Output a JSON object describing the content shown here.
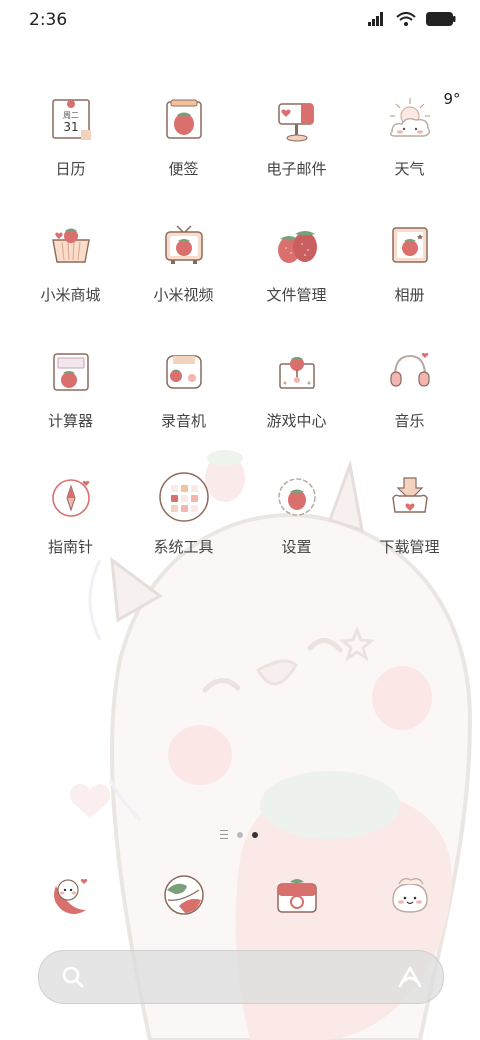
{
  "status_bar": {
    "time": "2:36"
  },
  "apps": [
    {
      "label": "日历",
      "icon": "calendar-icon",
      "calendar_day": "周二",
      "calendar_date": "31"
    },
    {
      "label": "便签",
      "icon": "notes-icon"
    },
    {
      "label": "电子邮件",
      "icon": "email-icon"
    },
    {
      "label": "天气",
      "icon": "weather-icon",
      "temperature": "9°"
    },
    {
      "label": "小米商城",
      "icon": "mi-store-icon"
    },
    {
      "label": "小米视频",
      "icon": "mi-video-icon"
    },
    {
      "label": "文件管理",
      "icon": "file-manager-icon"
    },
    {
      "label": "相册",
      "icon": "gallery-icon"
    },
    {
      "label": "计算器",
      "icon": "calculator-icon"
    },
    {
      "label": "录音机",
      "icon": "recorder-icon"
    },
    {
      "label": "游戏中心",
      "icon": "game-center-icon"
    },
    {
      "label": "音乐",
      "icon": "music-icon"
    },
    {
      "label": "指南针",
      "icon": "compass-icon"
    },
    {
      "label": "系统工具",
      "icon": "system-tools-folder-icon"
    },
    {
      "label": "设置",
      "icon": "settings-icon"
    },
    {
      "label": "下载管理",
      "icon": "downloads-icon"
    }
  ],
  "dock": [
    {
      "icon": "phone-icon"
    },
    {
      "icon": "browser-icon"
    },
    {
      "icon": "camera-icon"
    },
    {
      "icon": "messages-icon"
    }
  ],
  "pager": {
    "pages": 2,
    "active": 2
  },
  "colors": {
    "strawberry": "#d9706e",
    "pink": "#f3b5b0",
    "leaf": "#7aa07a",
    "outline": "#8c6b5d"
  }
}
